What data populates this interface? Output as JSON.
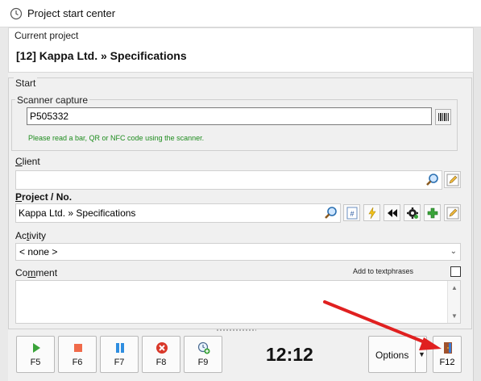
{
  "window": {
    "title": "Project start center"
  },
  "current_project": {
    "label": "Current project",
    "value": "[12] Kappa Ltd. » Specifications"
  },
  "start": {
    "group_label": "Start",
    "scanner": {
      "group_label": "Scanner capture",
      "value": "P505332",
      "hint": "Please read a bar, QR or NFC code using the scanner."
    },
    "client": {
      "label_pre": "",
      "label_u": "C",
      "label_post": "lient",
      "value": ""
    },
    "project": {
      "label_pre": "",
      "label_u": "P",
      "label_post": "roject / No.",
      "value": "Kappa Ltd. » Specifications"
    },
    "activity": {
      "label_pre": "Ac",
      "label_u": "t",
      "label_post": "ivity",
      "value": "< none >"
    },
    "comment": {
      "label_pre": "Co",
      "label_u": "m",
      "label_post": "ment",
      "add_to_textphrases": "Add to textphrases",
      "value": ""
    }
  },
  "toolbar": {
    "keys": [
      {
        "label": "F5",
        "icon": "play-icon",
        "color": "#3aa33a"
      },
      {
        "label": "F6",
        "icon": "stop-icon",
        "color": "#f06a4a"
      },
      {
        "label": "F7",
        "icon": "pause-icon",
        "color": "#2f8ee0"
      },
      {
        "label": "F8",
        "icon": "cancel-icon",
        "color": "#d9382a"
      },
      {
        "label": "F9",
        "icon": "clock-add-icon",
        "color": "#3aa33a"
      }
    ],
    "timer": "12:12",
    "options_label": "Options",
    "exit_label": "F12"
  },
  "colors": {
    "accent_red": "#e02020",
    "hint_green": "#1e8c1e"
  }
}
